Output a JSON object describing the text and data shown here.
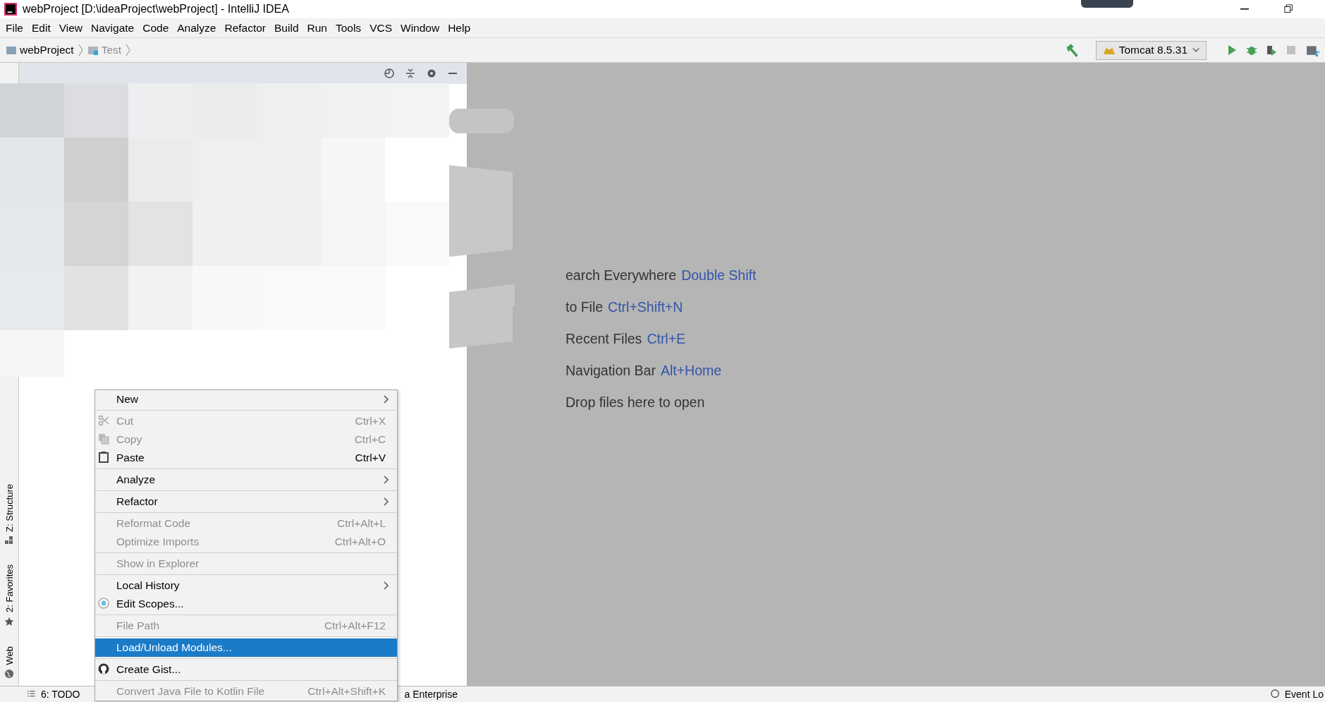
{
  "window": {
    "title": "webProject [D:\\ideaProject\\webProject] - IntelliJ IDEA"
  },
  "menu_bar": [
    "File",
    "Edit",
    "View",
    "Navigate",
    "Code",
    "Analyze",
    "Refactor",
    "Build",
    "Run",
    "Tools",
    "VCS",
    "Window",
    "Help"
  ],
  "breadcrumbs": [
    {
      "label": "webProject",
      "disabled": false
    },
    {
      "label": "Test",
      "disabled": true
    }
  ],
  "run_config": {
    "label": "Tomcat 8.5.31"
  },
  "left_stripe": [
    {
      "label": "Z: Structure",
      "kind": "structure"
    },
    {
      "label": "2: Favorites",
      "kind": "favorites"
    },
    {
      "label": "Web",
      "kind": "web"
    }
  ],
  "welcome": [
    {
      "label": "earch Everywhere",
      "shortcut": "Double Shift"
    },
    {
      "label": "to File",
      "shortcut": "Ctrl+Shift+N"
    },
    {
      "label": "Recent Files",
      "shortcut": "Ctrl+E"
    },
    {
      "label": "Navigation Bar",
      "shortcut": "Alt+Home"
    },
    {
      "label": "Drop files here to open"
    }
  ],
  "context_menu": [
    {
      "kind": "item",
      "label": "New",
      "submenu": true,
      "disabled": false,
      "selected": false
    },
    {
      "kind": "separator"
    },
    {
      "kind": "cut",
      "label": "Cut",
      "shortcut": "Ctrl+X",
      "disabled": true,
      "selected": false
    },
    {
      "kind": "copy",
      "label": "Copy",
      "shortcut": "Ctrl+C",
      "disabled": true,
      "selected": false
    },
    {
      "kind": "paste",
      "label": "Paste",
      "shortcut": "Ctrl+V",
      "disabled": false,
      "selected": false
    },
    {
      "kind": "separator"
    },
    {
      "kind": "item",
      "label": "Analyze",
      "submenu": true,
      "disabled": false,
      "selected": false
    },
    {
      "kind": "separator"
    },
    {
      "kind": "item",
      "label": "Refactor",
      "submenu": true,
      "disabled": false,
      "selected": false
    },
    {
      "kind": "separator"
    },
    {
      "kind": "item",
      "label": "Reformat Code",
      "shortcut": "Ctrl+Alt+L",
      "disabled": true,
      "selected": false
    },
    {
      "kind": "item",
      "label": "Optimize Imports",
      "shortcut": "Ctrl+Alt+O",
      "disabled": true,
      "selected": false
    },
    {
      "kind": "separator"
    },
    {
      "kind": "item",
      "label": "Show in Explorer",
      "disabled": true,
      "selected": false
    },
    {
      "kind": "separator"
    },
    {
      "kind": "item",
      "label": "Local History",
      "submenu": true,
      "disabled": false,
      "selected": false
    },
    {
      "kind": "scopes",
      "label": "Edit Scopes...",
      "disabled": false,
      "selected": false
    },
    {
      "kind": "separator"
    },
    {
      "kind": "item",
      "label": "File Path",
      "shortcut": "Ctrl+Alt+F12",
      "disabled": true,
      "selected": false
    },
    {
      "kind": "separator"
    },
    {
      "kind": "item",
      "label": "Load/Unload Modules...",
      "disabled": false,
      "selected": true
    },
    {
      "kind": "separator"
    },
    {
      "kind": "gist",
      "label": "Create Gist...",
      "disabled": false,
      "selected": false
    },
    {
      "kind": "separator"
    },
    {
      "kind": "item",
      "label": "Convert Java File to Kotlin File",
      "shortcut": "Ctrl+Alt+Shift+K",
      "disabled": true,
      "selected": false
    }
  ],
  "status_bar": {
    "left": [
      {
        "label": "6: TODO"
      },
      {
        "label": "a Enterprise"
      }
    ],
    "right": {
      "label": "Event Lo"
    }
  }
}
